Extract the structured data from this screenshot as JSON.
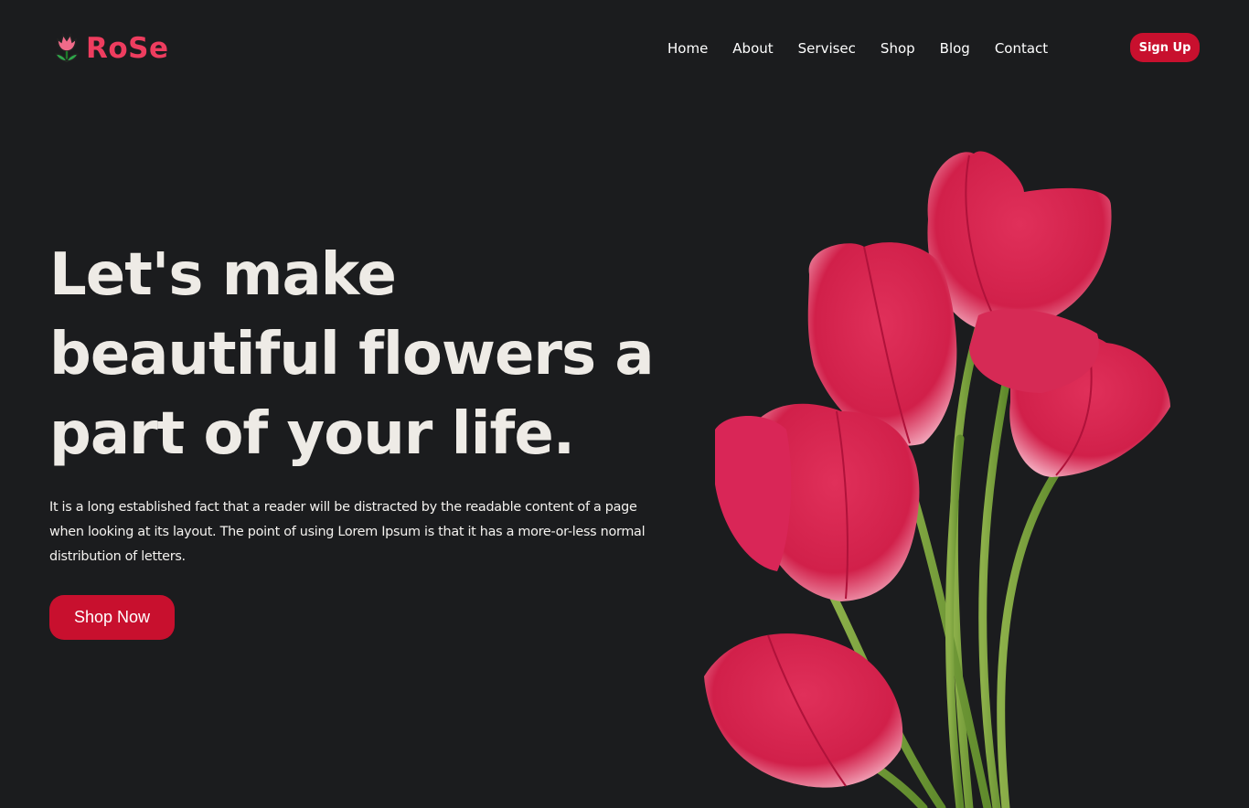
{
  "brand": {
    "name": "RoSe",
    "logo_icon": "tulip-icon",
    "color": "#ee3d5f"
  },
  "nav": {
    "items": [
      {
        "label": "Home"
      },
      {
        "label": "About"
      },
      {
        "label": "Servisec"
      },
      {
        "label": "Shop"
      },
      {
        "label": "Blog"
      },
      {
        "label": "Contact"
      }
    ],
    "signup_label": "Sign Up"
  },
  "hero": {
    "title": "Let's make beautiful flowers a part of your life.",
    "description": "It is a long established fact that a reader will be distracted by the readable content of a page when looking at its layout. The point of using Lorem Ipsum is that it has a more-or-less normal distribution of letters.",
    "cta_label": "Shop Now",
    "image": "pink-tulip-bouquet"
  },
  "colors": {
    "background": "#1b1c1e",
    "accent": "#c8102e",
    "title_text": "#eeebe6"
  }
}
